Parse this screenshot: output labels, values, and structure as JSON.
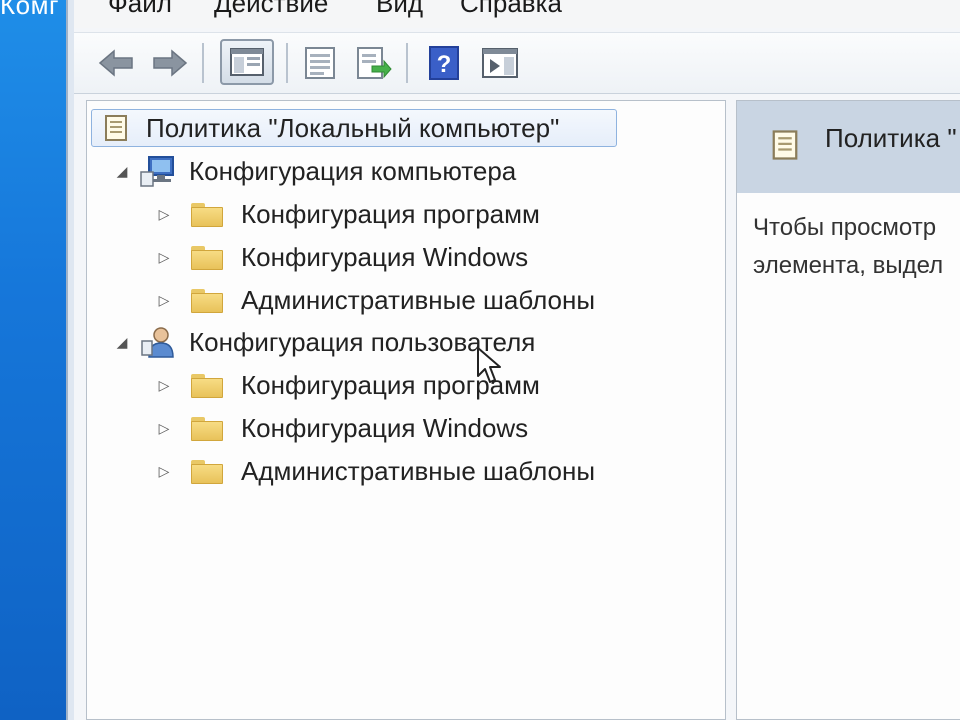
{
  "desktop": {
    "title": "Комг"
  },
  "menu": [
    "Файл",
    "Действие",
    "Вид",
    "Справка"
  ],
  "toolbar": {
    "icons": [
      "back-arrow-icon",
      "forward-arrow-icon",
      "show-hide-tree-icon",
      "properties-icon",
      "export-list-icon",
      "help-icon",
      "action-pane-icon"
    ]
  },
  "tree": {
    "root": "Политика \"Локальный компьютер\"",
    "sections": [
      {
        "label": "Конфигурация компьютера",
        "icon": "computer-config-icon",
        "children": [
          "Конфигурация программ",
          "Конфигурация Windows",
          "Административные шаблоны"
        ]
      },
      {
        "label": "Конфигурация пользователя",
        "icon": "user-config-icon",
        "children": [
          "Конфигурация программ",
          "Конфигурация Windows",
          "Административные шаблоны"
        ]
      }
    ]
  },
  "right_pane": {
    "title": "Политика \"",
    "description_line1": "Чтобы просмотр",
    "description_line2": "элемента, выдел"
  },
  "colors": {
    "desktop": "#1677da",
    "header": "#c9d5e3",
    "folder": "#f0d070"
  }
}
